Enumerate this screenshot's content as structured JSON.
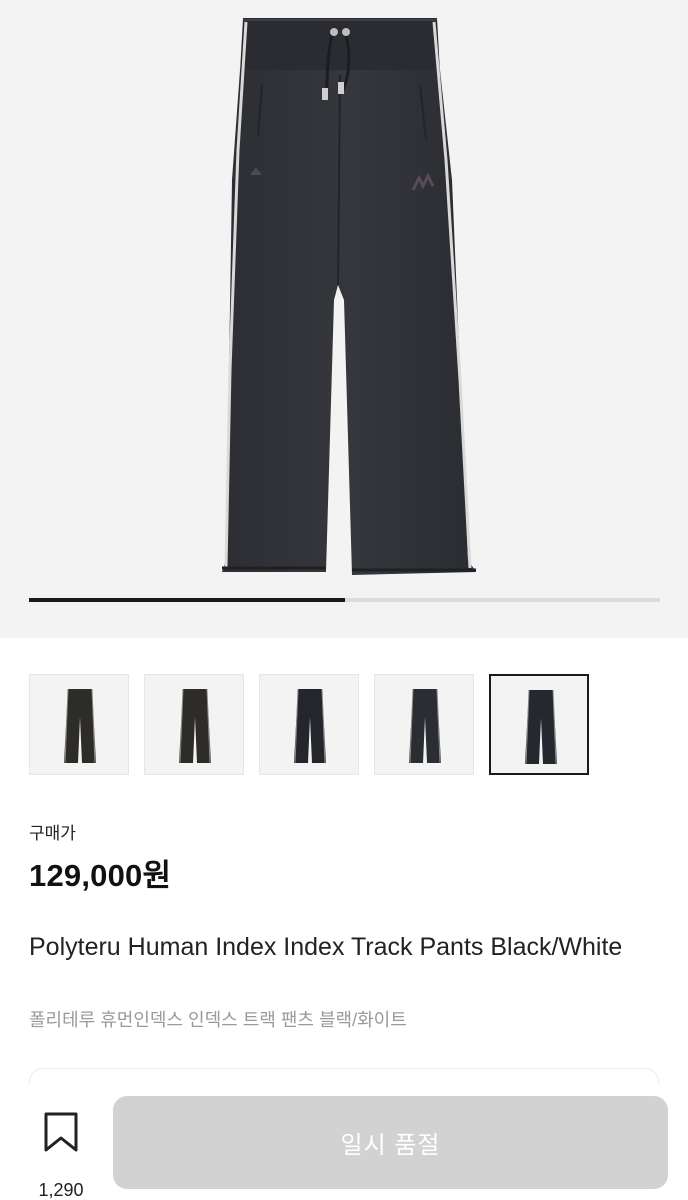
{
  "gallery": {
    "image_alt": "Black track pants with white side piping",
    "slide_progress": 0.5,
    "thumbnails": [
      {
        "tone": "#2e2c28",
        "selected": false
      },
      {
        "tone": "#2e2c28",
        "selected": false
      },
      {
        "tone": "#24262c",
        "selected": false
      },
      {
        "tone": "#2a2d32",
        "selected": false
      },
      {
        "tone": "#25282e",
        "selected": true
      }
    ]
  },
  "product": {
    "price_label": "구매가",
    "price": "129,000원",
    "title_en": "Polyteru Human Index Index Track Pants Black/White",
    "title_ko": "폴리테루 휴먼인덱스 인덱스 트랙 팬츠 블랙/화이트"
  },
  "action_bar": {
    "bookmark_icon": "bookmark-icon",
    "bookmark_count": "1,290",
    "primary_button_label": "일시 품절"
  },
  "colors": {
    "accent": "#1a1a1a",
    "disabled_button": "#d2d2d2",
    "muted_text": "#9a9a9a"
  }
}
